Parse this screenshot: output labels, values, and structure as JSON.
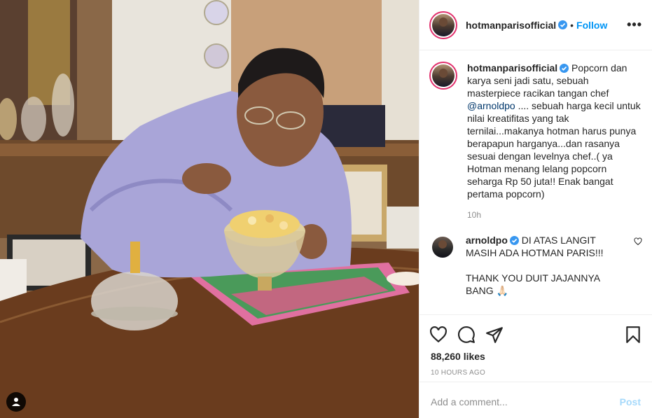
{
  "post": {
    "username": "hotmanparisofficial",
    "follow_label": "Follow",
    "dot": "•",
    "more_label": "•••",
    "image_alt": "Man in lavender bathrobe eating popcorn from a glass bowl at a dining table"
  },
  "caption": {
    "username": "hotmanparisofficial",
    "text_before": "Popcorn dan karya seni jadi satu, sebuah masterpiece racikan tangan chef ",
    "mention": "@arnoldpo",
    "text_after": " .... sebuah harga kecil untuk nilai kreatifitas yang tak ternilai...makanya hotman harus punya berapapun harganya...dan rasanya sesuai dengan levelnya chef..( ya Hotman menang lelang popcorn seharga Rp 50 juta!! Enak bangat pertama popcorn)",
    "age": "10h"
  },
  "reply": {
    "username": "arnoldpo",
    "line1": "DI ATAS LANGIT MASIH ADA HOTMAN PARIS!!!",
    "line2": "THANK YOU DUIT JAJANNYA BANG 🙏🏻"
  },
  "actions": {
    "likes": "88,260 likes",
    "timestamp": "10 HOURS AGO"
  },
  "composer": {
    "placeholder": "Add a comment...",
    "post_label": "Post"
  },
  "colors": {
    "accent": "#0095f6",
    "verified": "#3897f0",
    "story_ring": "#e1306c"
  },
  "icons": [
    "user-tag-icon",
    "verified-icon",
    "more-icon",
    "heart-icon",
    "comment-icon",
    "share-icon",
    "bookmark-icon"
  ]
}
